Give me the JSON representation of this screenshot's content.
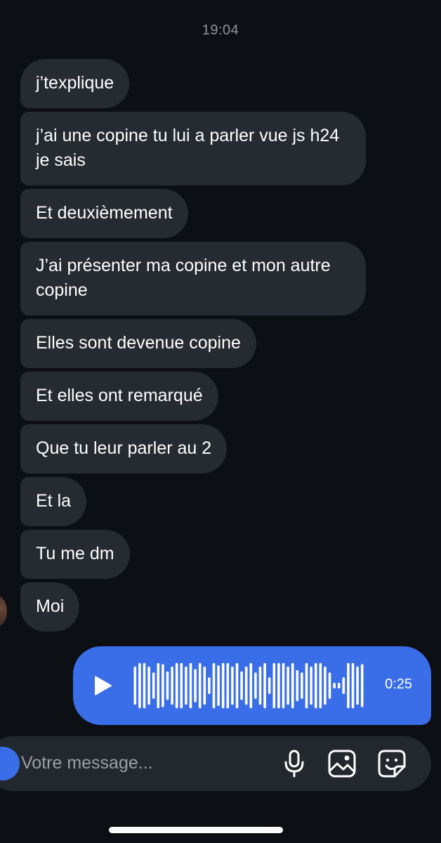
{
  "conversation": {
    "timestamp": "19:04",
    "messages": [
      "j’texplique",
      "j’ai une copine tu lui a parler vue js h24 je sais",
      "Et deuxièmement",
      "J’ai présenter ma copine et mon autre copine",
      "Elles sont devenue copine",
      "Et elles ont remarqué",
      "Que tu leur parler au 2",
      "Et la",
      "Tu me dm",
      "Moi"
    ],
    "voice_message": {
      "duration": "0:25",
      "play_icon": "play-icon",
      "bar_levels": [
        0.8,
        0.95,
        0.95,
        0.8,
        0.55,
        0.95,
        0.9,
        0.6,
        0.8,
        0.95,
        0.95,
        0.8,
        0.95,
        0.7,
        0.95,
        0.8,
        0.35,
        0.95,
        0.85,
        0.95,
        0.95,
        0.8,
        0.95,
        0.6,
        0.8,
        0.95,
        0.55,
        0.8,
        0.95,
        0.35,
        0.95,
        0.95,
        0.95,
        0.8,
        0.95,
        0.65,
        0.55,
        0.95,
        0.8,
        0.95,
        0.95,
        0.8,
        0.55,
        0.12,
        0.12,
        0.35,
        0.95,
        0.95,
        0.8,
        0.9
      ]
    }
  },
  "composer": {
    "placeholder": "Votre message...",
    "icons": [
      "microphone-icon",
      "image-icon",
      "sticker-icon"
    ]
  },
  "colors": {
    "background": "#0c0f14",
    "incoming_bubble": "#262a31",
    "outgoing_bubble": "#3a6ee8"
  }
}
